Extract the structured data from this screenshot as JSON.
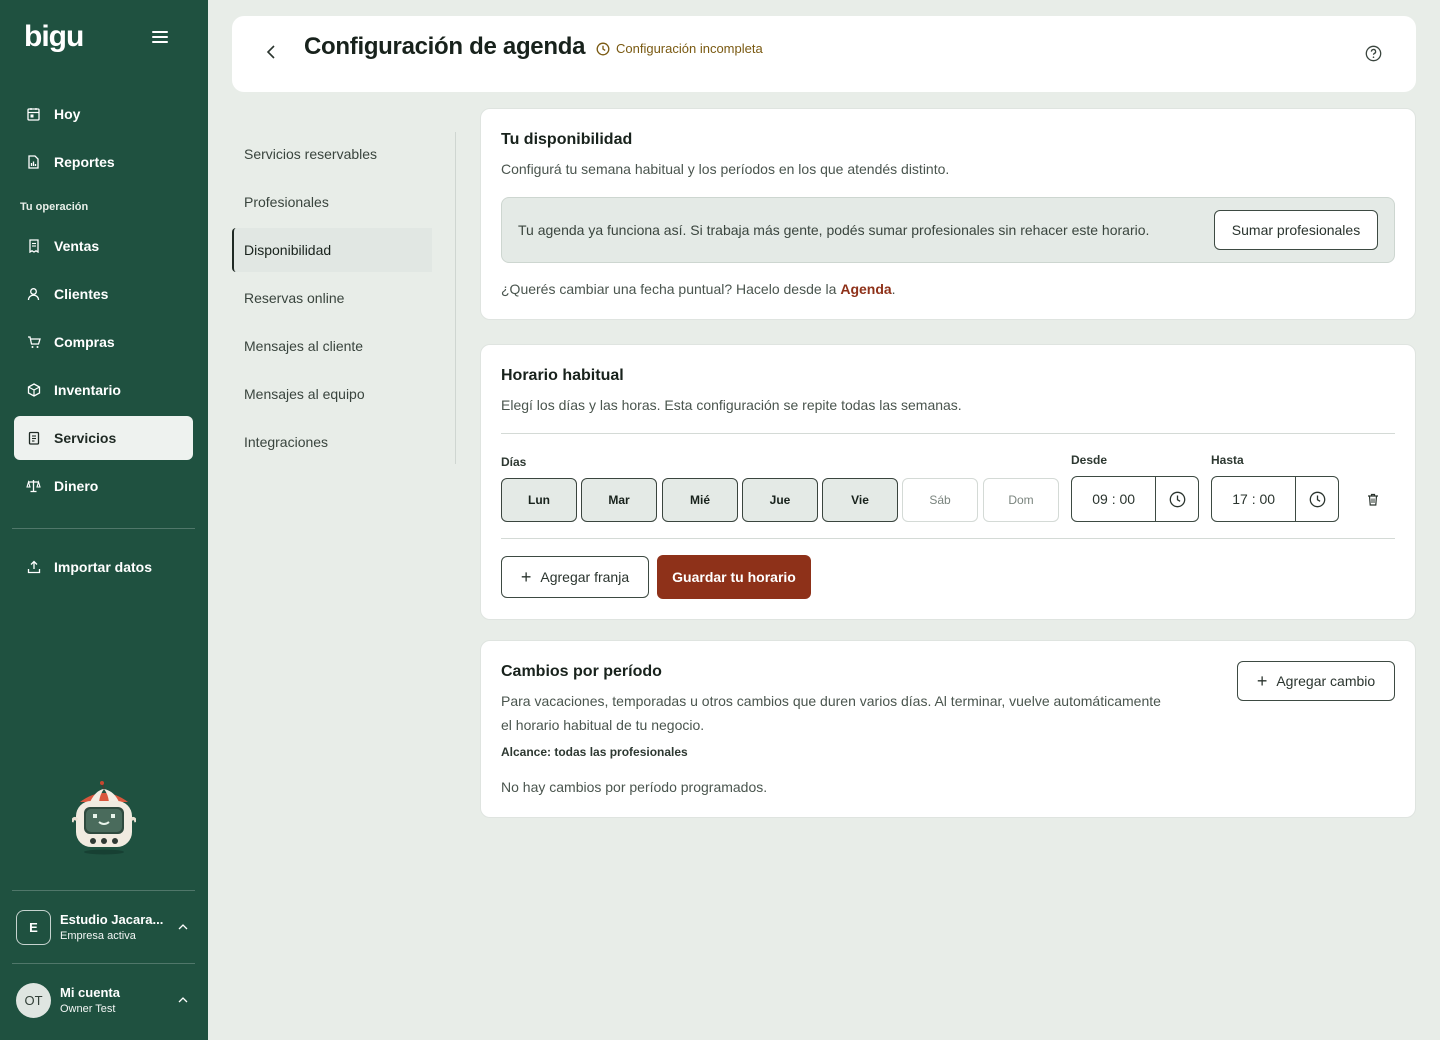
{
  "sidebar": {
    "logo": "bigu",
    "items": [
      {
        "label": "Hoy",
        "icon": "calendar-icon"
      },
      {
        "label": "Reportes",
        "icon": "report-icon"
      }
    ],
    "section_label": "Tu operación",
    "operation_items": [
      {
        "label": "Ventas",
        "icon": "receipt-icon"
      },
      {
        "label": "Clientes",
        "icon": "user-icon"
      },
      {
        "label": "Compras",
        "icon": "cart-icon"
      },
      {
        "label": "Inventario",
        "icon": "box-icon"
      },
      {
        "label": "Servicios",
        "icon": "clipboard-icon",
        "active": true
      },
      {
        "label": "Dinero",
        "icon": "scale-icon"
      }
    ],
    "import_label": "Importar datos",
    "business": {
      "initial": "E",
      "name": "Estudio Jacara...",
      "status": "Empresa activa"
    },
    "user": {
      "initials": "OT",
      "name": "Mi cuenta",
      "sub": "Owner Test"
    }
  },
  "header": {
    "title": "Configuración de agenda",
    "status": "Configuración incompleta",
    "status_color": "#7a5a12"
  },
  "subnav": [
    {
      "label": "Servicios reservables"
    },
    {
      "label": "Profesionales"
    },
    {
      "label": "Disponibilidad",
      "active": true
    },
    {
      "label": "Reservas online"
    },
    {
      "label": "Mensajes al cliente"
    },
    {
      "label": "Mensajes al equipo"
    },
    {
      "label": "Integraciones"
    }
  ],
  "availability": {
    "title": "Tu disponibilidad",
    "desc": "Configurá tu semana habitual y los períodos en los que atendés distinto.",
    "info": "Tu agenda ya funciona así. Si trabaja más gente, podés sumar profesionales sin rehacer este horario.",
    "add_pros_button": "Sumar profesionales",
    "note_prefix": "¿Querés cambiar una fecha puntual? Hacelo desde la ",
    "note_link": "Agenda",
    "note_suffix": "."
  },
  "schedule": {
    "title": "Horario habitual",
    "desc": "Elegí los días y las horas. Esta configuración se repite todas las semanas.",
    "days_label": "Días",
    "days": [
      {
        "label": "Lun",
        "selected": true
      },
      {
        "label": "Mar",
        "selected": true
      },
      {
        "label": "Mié",
        "selected": true
      },
      {
        "label": "Jue",
        "selected": true
      },
      {
        "label": "Vie",
        "selected": true
      },
      {
        "label": "Sáb",
        "selected": false
      },
      {
        "label": "Dom",
        "selected": false
      }
    ],
    "from_label": "Desde",
    "from_value": "09 : 00",
    "to_label": "Hasta",
    "to_value": "17 : 00",
    "add_slot_button": "Agregar franja",
    "save_button": "Guardar tu horario"
  },
  "period_changes": {
    "title": "Cambios por período",
    "desc_line1": "Para vacaciones, temporadas u otros cambios que duren varios días. Al terminar, vuelve automáticamente",
    "desc_line2": "el horario habitual de tu negocio.",
    "scope": "Alcance: todas las profesionales",
    "empty": "No hay cambios por período programados.",
    "add_button": "Agregar cambio"
  },
  "colors": {
    "sidebar": "#1f5140",
    "primary": "#8e3119",
    "background": "#e8ede8"
  }
}
